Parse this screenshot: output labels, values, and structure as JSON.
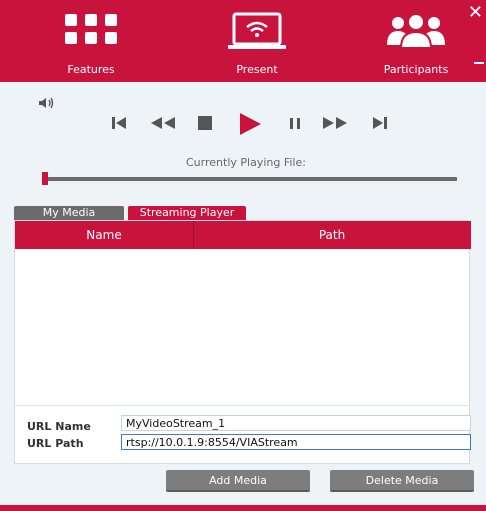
{
  "topbar": {
    "features_label": "Features",
    "present_label": "Present",
    "participants_label": "Participants",
    "close_glyph": "✕"
  },
  "player": {
    "currently_playing_label": "Currently Playing File:",
    "progress": 0.0,
    "accent_color": "#c8143c"
  },
  "tabs": {
    "my_media": "My Media",
    "streaming_player": "Streaming Player",
    "active": "streaming_player"
  },
  "table": {
    "columns": [
      "Name",
      "Path"
    ],
    "rows": []
  },
  "form": {
    "url_name_label": "URL Name",
    "url_name_value": "MyVideoStream_1",
    "url_path_label": "URL Path",
    "url_path_value": "rtsp://10.0.1.9:8554/VIAStream"
  },
  "buttons": {
    "add": "Add Media",
    "delete": "Delete Media"
  }
}
